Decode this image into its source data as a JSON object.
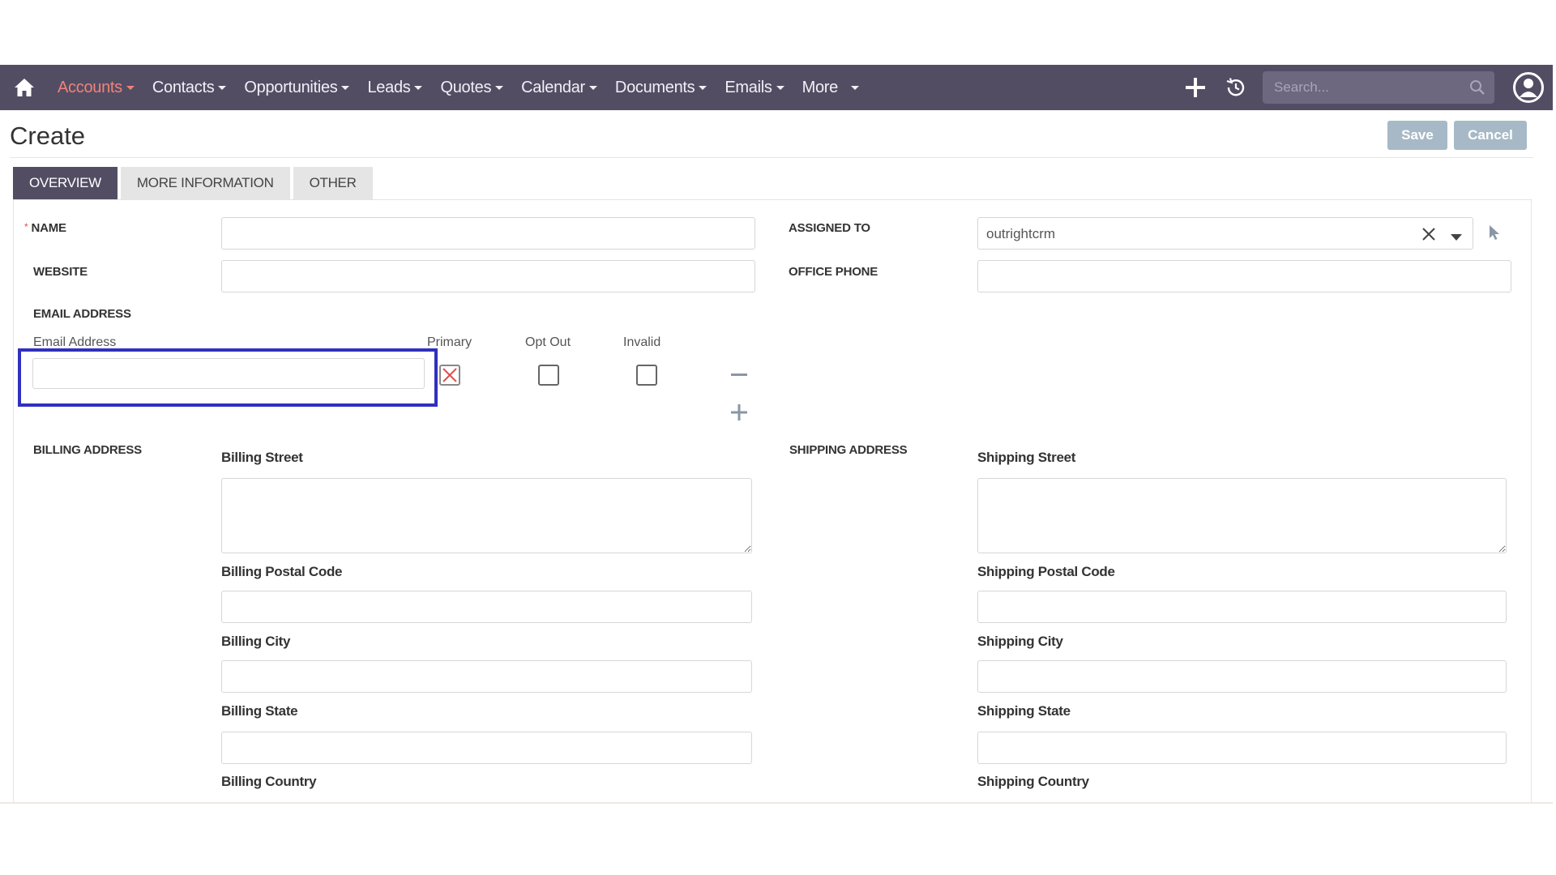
{
  "nav": {
    "items": [
      {
        "label": "Accounts",
        "active": true
      },
      {
        "label": "Contacts",
        "active": false
      },
      {
        "label": "Opportunities",
        "active": false
      },
      {
        "label": "Leads",
        "active": false
      },
      {
        "label": "Quotes",
        "active": false
      },
      {
        "label": "Calendar",
        "active": false
      },
      {
        "label": "Documents",
        "active": false
      },
      {
        "label": "Emails",
        "active": false
      },
      {
        "label": "More",
        "active": false
      }
    ],
    "search_placeholder": "Search..."
  },
  "header": {
    "title": "Create",
    "save_label": "Save",
    "cancel_label": "Cancel"
  },
  "tabs": [
    "OVERVIEW",
    "MORE INFORMATION",
    "OTHER"
  ],
  "form": {
    "name_label": "NAME",
    "website_label": "WEBSITE",
    "email_section_label": "EMAIL ADDRESS",
    "email_col_label": "Email Address",
    "primary_label": "Primary",
    "optout_label": "Opt Out",
    "invalid_label": "Invalid",
    "assigned_label": "ASSIGNED TO",
    "assigned_value": "outrightcrm",
    "office_phone_label": "OFFICE PHONE",
    "billing_label": "BILLING ADDRESS",
    "billing_street": "Billing Street",
    "billing_postal": "Billing Postal Code",
    "billing_city": "Billing City",
    "billing_state": "Billing State",
    "billing_country": "Billing Country",
    "shipping_label": "SHIPPING ADDRESS",
    "shipping_street": "Shipping Street",
    "shipping_postal": "Shipping Postal Code",
    "shipping_city": "Shipping City",
    "shipping_state": "Shipping State",
    "shipping_country": "Shipping Country"
  },
  "colors": {
    "navbar": "#534d64",
    "active_nav": "#f08377",
    "button": "#a7b9c6",
    "highlight": "#3030c0"
  }
}
